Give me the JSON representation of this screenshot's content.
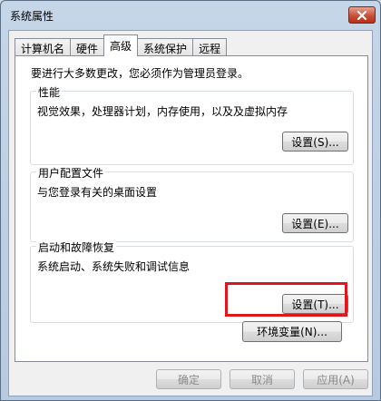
{
  "window": {
    "title": "系统属性"
  },
  "tabs": [
    {
      "label": "计算机名",
      "active": false
    },
    {
      "label": "硬件",
      "active": false
    },
    {
      "label": "高级",
      "active": true
    },
    {
      "label": "系统保护",
      "active": false
    },
    {
      "label": "远程",
      "active": false
    }
  ],
  "advanced": {
    "admin_note": "要进行大多数更改，您必须作为管理员登录。",
    "performance": {
      "title": "性能",
      "description": "视觉效果，处理器计划，内存使用，以及及虚拟内存",
      "button": "设置(S)..."
    },
    "user_profiles": {
      "title": "用户配置文件",
      "description": "与您登录有关的桌面设置",
      "button": "设置(E)..."
    },
    "startup_recovery": {
      "title": "启动和故障恢复",
      "description": "系统启动、系统失败和调试信息",
      "button": "设置(T)..."
    },
    "env_button": "环境变量(N)..."
  },
  "footer": {
    "ok": "确定",
    "cancel": "取消",
    "apply": "应用(A)"
  },
  "colors": {
    "highlight": "#e0161a",
    "close_button": "#c75039"
  }
}
